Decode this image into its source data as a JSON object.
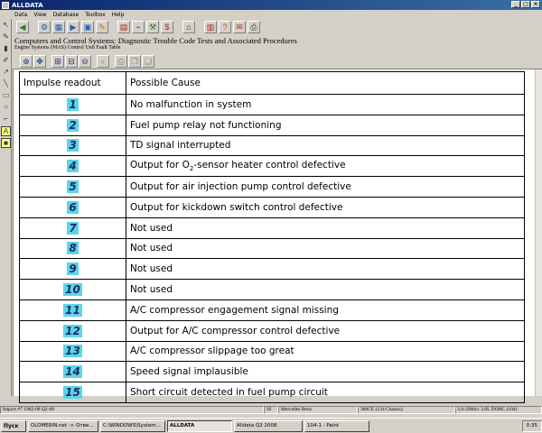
{
  "window": {
    "title": "ALLDATA"
  },
  "menu": [
    "Data",
    "View",
    "Database",
    "Toolbox",
    "Help"
  ],
  "procedure": {
    "title": "Computers and Control Systems:  Diagnostic Trouble Code Tests and Associated Procedures",
    "subtitle": "Engine Systems (MAS) Control Unit Fault Table"
  },
  "table": {
    "headers": [
      "Impulse readout",
      "Possible Cause"
    ],
    "rows": [
      {
        "code": "1",
        "cause": "No malfunction in system"
      },
      {
        "code": "2",
        "cause": "Fuel pump relay not functioning"
      },
      {
        "code": "3",
        "cause": "TD signal interrupted"
      },
      {
        "code": "4",
        "cause_pre": "Output for O",
        "cause_sub": "2",
        "cause_post": "-sensor heater control defective"
      },
      {
        "code": "5",
        "cause": "Output for air injection pump control defective"
      },
      {
        "code": "6",
        "cause": "Output for kickdown switch control defective"
      },
      {
        "code": "7",
        "cause": "Not used"
      },
      {
        "code": "8",
        "cause": "Not used"
      },
      {
        "code": "9",
        "cause": "Not used"
      },
      {
        "code": "10",
        "cause": "Not used"
      },
      {
        "code": "11",
        "cause": "A/C compressor engagement signal missing"
      },
      {
        "code": "12",
        "cause": "Output for A/C compressor control defective"
      },
      {
        "code": "13",
        "cause": "A/C compressor slippage too great"
      },
      {
        "code": "14",
        "cause": "Speed signal implausible"
      },
      {
        "code": "15",
        "cause": "Short circuit detected in fuel pump circuit"
      }
    ]
  },
  "statusbar": {
    "import": "Import #7 1982-08 Q2-08",
    "page": "92",
    "make": "Mercedes Benz",
    "chassis": "380CE (124 Chassis)",
    "engine": "L6-2960cc 3.0L DOHC (104)"
  },
  "taskbar": {
    "start": "Пуск",
    "tasks": [
      "OLOMERIN.net -> Отве...",
      "C:\\WINDOWS\\System...",
      "ALLDATA",
      "Alldata Q2 2008",
      "104-1 - Paint"
    ],
    "active_index": 2,
    "clock": "0:35"
  },
  "colors": {
    "badge": "#5cd6e6",
    "titlebar": "#0a246a"
  }
}
